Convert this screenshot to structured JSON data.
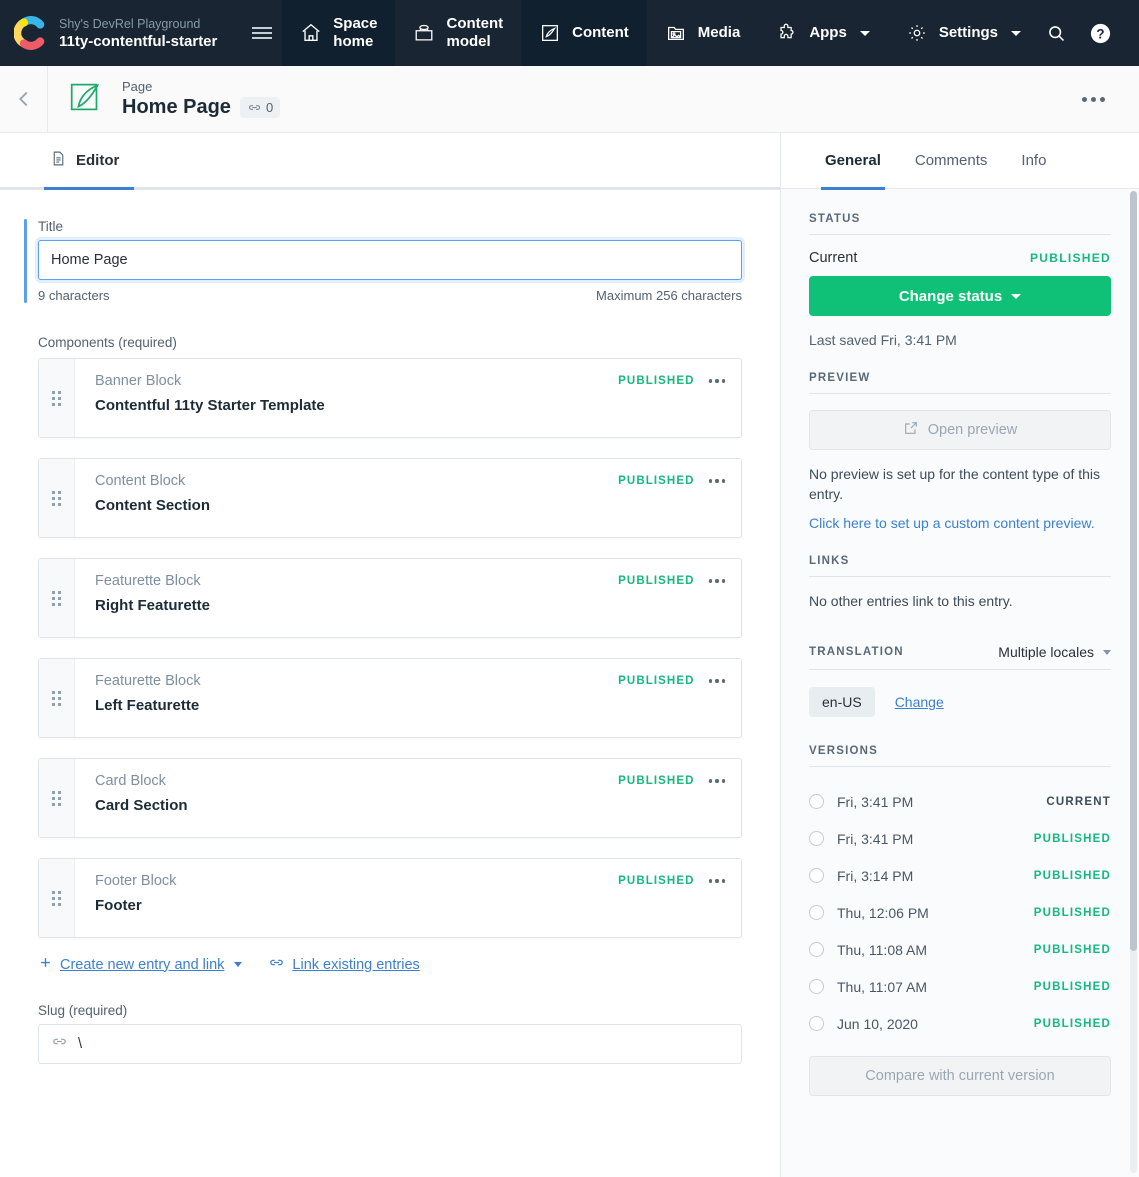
{
  "topnav": {
    "org": "Shy's DevRel Playground",
    "space": "11ty-contentful-starter",
    "items": [
      {
        "label": "Space home",
        "icon": "home-icon",
        "active": false,
        "caret": false
      },
      {
        "label": "Content model",
        "icon": "box-icon",
        "active": false,
        "caret": false
      },
      {
        "label": "Content",
        "icon": "pen-square-icon",
        "active": true,
        "caret": false
      },
      {
        "label": "Media",
        "icon": "media-icon",
        "active": false,
        "caret": false
      },
      {
        "label": "Apps",
        "icon": "puzzle-icon",
        "active": false,
        "caret": true
      },
      {
        "label": "Settings",
        "icon": "gear-icon",
        "active": false,
        "caret": true
      }
    ],
    "search_icon": "search-icon",
    "help_icon": "help-icon"
  },
  "page_header": {
    "entry_type": "Page",
    "entry_title": "Home Page",
    "link_count": "0",
    "back_icon": "chevron-left-icon",
    "entry_icon": "page-feather-icon",
    "more_icon": "ellipsis-icon"
  },
  "editor": {
    "tab_label": "Editor",
    "tab_icon": "document-icon",
    "title_field": {
      "label": "Title",
      "value": "Home Page",
      "char_count": "9 characters",
      "max_note": "Maximum 256 characters"
    },
    "components_label": "Components (required)",
    "components": [
      {
        "content_type": "Banner Block",
        "title": "Contentful 11ty Starter Template",
        "status": "PUBLISHED"
      },
      {
        "content_type": "Content Block",
        "title": "Content Section",
        "status": "PUBLISHED"
      },
      {
        "content_type": "Featurette Block",
        "title": "Right Featurette",
        "status": "PUBLISHED"
      },
      {
        "content_type": "Featurette Block",
        "title": "Left Featurette",
        "status": "PUBLISHED"
      },
      {
        "content_type": "Card Block",
        "title": "Card Section",
        "status": "PUBLISHED"
      },
      {
        "content_type": "Footer Block",
        "title": "Footer",
        "status": "PUBLISHED"
      }
    ],
    "create_link": "Create new entry and link",
    "link_existing": "Link existing entries",
    "slug_field": {
      "label": "Slug (required)",
      "value": "\\",
      "icon": "link-icon"
    }
  },
  "sidebar": {
    "tabs": [
      {
        "label": "General",
        "active": true
      },
      {
        "label": "Comments",
        "active": false
      },
      {
        "label": "Info",
        "active": false
      }
    ],
    "status": {
      "heading": "STATUS",
      "current_label": "Current",
      "current_value": "PUBLISHED",
      "button": "Change status",
      "last_saved": "Last saved Fri, 3:41 PM"
    },
    "preview": {
      "heading": "PREVIEW",
      "button": "Open preview",
      "button_icon": "external-link-icon",
      "note": "No preview is set up for the content type of this entry.",
      "link": "Click here to set up a custom content preview."
    },
    "links": {
      "heading": "LINKS",
      "note": "No other entries link to this entry."
    },
    "translation": {
      "heading": "TRANSLATION",
      "selector": "Multiple locales",
      "locale": "en-US",
      "change": "Change"
    },
    "versions": {
      "heading": "VERSIONS",
      "items": [
        {
          "date": "Fri, 3:41 PM",
          "badge": "CURRENT",
          "badge_type": "current"
        },
        {
          "date": "Fri, 3:41 PM",
          "badge": "PUBLISHED",
          "badge_type": "published"
        },
        {
          "date": "Fri, 3:14 PM",
          "badge": "PUBLISHED",
          "badge_type": "published"
        },
        {
          "date": "Thu, 12:06 PM",
          "badge": "PUBLISHED",
          "badge_type": "published"
        },
        {
          "date": "Thu, 11:08 AM",
          "badge": "PUBLISHED",
          "badge_type": "published"
        },
        {
          "date": "Thu, 11:07 AM",
          "badge": "PUBLISHED",
          "badge_type": "published"
        },
        {
          "date": "Jun 10, 2020",
          "badge": "PUBLISHED",
          "badge_type": "published"
        }
      ],
      "compare_button": "Compare with current version"
    }
  },
  "colors": {
    "nav_bg": "#192532",
    "nav_active_bg": "#11202e",
    "accent_blue": "#3c80cf",
    "green": "#0fc177",
    "status_green": "#14b97f",
    "text_dark": "#1c2b36",
    "text_muted": "#536171"
  }
}
